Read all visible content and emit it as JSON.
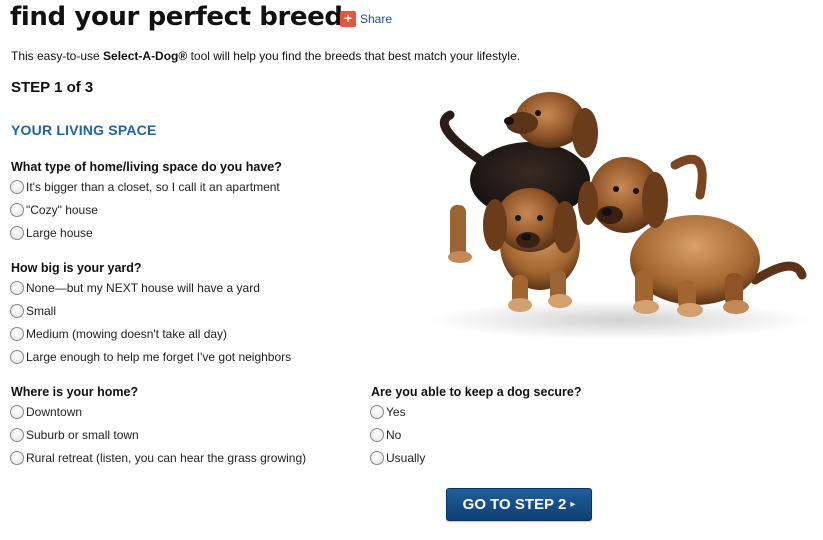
{
  "header": {
    "title": "find your perfect breed",
    "share_label": "Share",
    "share_icon": "plus-icon"
  },
  "intro": {
    "before": "This easy-to-use ",
    "tool_name": "Select-A-Dog®",
    "after": " tool will help you find the breeds that best match your lifestyle."
  },
  "step_label": "STEP 1 of 3",
  "section_title": "YOUR LIVING SPACE",
  "questions": {
    "home_type": {
      "label": "What type of home/living space do you have?",
      "options": [
        "It's bigger than a closet, so I call it an apartment",
        "\"Cozy\" house",
        "Large house"
      ]
    },
    "yard": {
      "label": "How big is your yard?",
      "options": [
        "None—but my NEXT house will have a yard",
        "Small",
        "Medium (mowing doesn't take all day)",
        "Large enough to help me forget I've got neighbors"
      ]
    },
    "location": {
      "label": "Where is your home?",
      "options": [
        "Downtown",
        "Suburb or small town",
        "Rural retreat (listen, you can hear the grass growing)"
      ]
    },
    "secure": {
      "label": "Are you able to keep a dog secure?",
      "options": [
        "Yes",
        "No",
        "Usually"
      ]
    }
  },
  "next_button": {
    "label": "GO TO STEP 2",
    "arrow": "▸"
  },
  "colors": {
    "accent_blue": "#1c64a8",
    "button_blue": "#0e3f73",
    "share_red": "#e8553a"
  }
}
